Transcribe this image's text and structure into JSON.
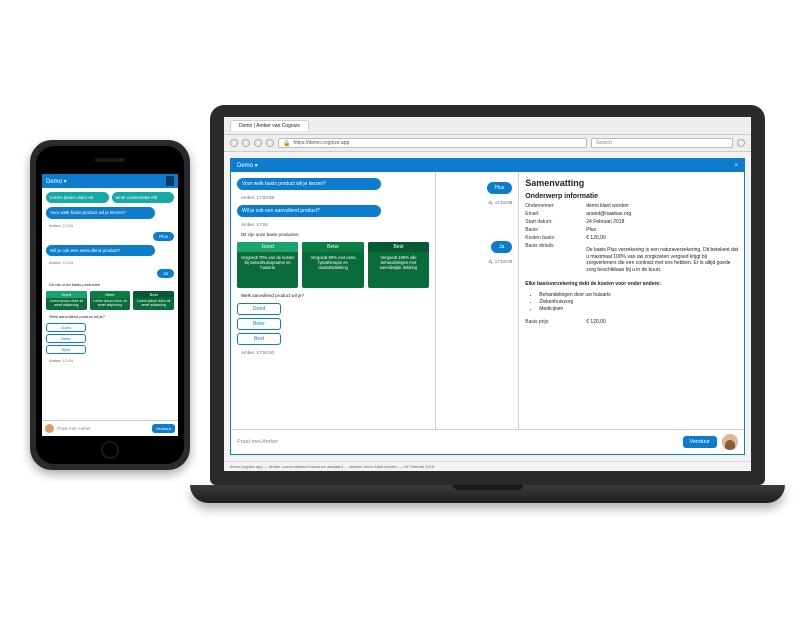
{
  "colors": {
    "primary": "#0d7ccd",
    "teal": "#17a9a7",
    "green": "#0a6b3c"
  },
  "phone": {
    "header_title": "Demo ▾",
    "intro1": "Lorem ipsum dolor sit",
    "intro2": "amet consectetur elit",
    "q1": "Voor welk basis product wil je kiezen?",
    "meta1": "Amber, 17:04",
    "reply1": "Plus",
    "q2": "Wil je ook een aanvullend product?",
    "meta2": "Amber, 17:04",
    "reply2": "Ja",
    "q3": "Dit zijn onze basis producten",
    "cards": [
      {
        "title": "Goed",
        "body": "Lorem ipsum dolor sit amet adipiscing"
      },
      {
        "title": "Beter",
        "body": "Lorem ipsum dolor sit amet adipiscing"
      },
      {
        "title": "Best",
        "body": "Lorem ipsum dolor sit amet adipiscing"
      }
    ],
    "q4": "Welk aanvullend product wil je?",
    "options": [
      "Goed",
      "Beter",
      "Best"
    ],
    "meta3": "Amber, 17:04",
    "input_placeholder": "Praat met Amber",
    "send": "Verstuur"
  },
  "browser": {
    "tab": "Demo | Amber van Cognize",
    "url": "https://demo.cognize.app",
    "search_placeholder": "Search"
  },
  "desktop": {
    "header_title": "Demo ▾",
    "q1": "Voor welk basis product wil je kiezen?",
    "meta1": "Amber, 17:03:59",
    "q2": "Wil je ook een aanvullend product?",
    "meta2": "Amber, 17:04",
    "q3": "Dit zijn onze basis producten",
    "cards": [
      {
        "title": "Goed",
        "body": "Vergoedt 70% van de kosten bij ziekenhuisopname en huisarts"
      },
      {
        "title": "Beter",
        "body": "Vergoedt 90% met extra fysiotherapie en tandartsdekking"
      },
      {
        "title": "Best",
        "body": "Vergoedt 100% alle behandelingen met wereldwijde dekking"
      }
    ],
    "q4": "Welk aanvullend product wil je?",
    "options": [
      "Goed",
      "Beter",
      "Best"
    ],
    "meta3": "Amber, 17:04:20",
    "responses": {
      "r1": "Plus",
      "r1_meta": "Jij, 17:03:59",
      "r2": "Ja",
      "r2_meta": "Jij, 17:04:09"
    },
    "input_placeholder": "Praat met Amber",
    "send": "Verstuur",
    "status": "demo.cognize.app — Amber conversational insurance assistant — session demo klant worden — 24 Februari 2018"
  },
  "summary": {
    "title": "Samenvatting",
    "section": "Onderwerp informatie",
    "rows": {
      "ondernemer_k": "Ondernemer:",
      "ondernemer_v": "demo klant worden",
      "email_k": "Email:",
      "email_v": "anand@nawbas.org",
      "start_k": "Start datum:",
      "start_v": "24 Februari 2018",
      "basis_k": "Basis:",
      "basis_v": "Plus",
      "kosten_k": "Kosten basis:",
      "kosten_v": "€ 120,00",
      "details_k": "Basis details:"
    },
    "para": "De basis Plus verzekering is een naturaverzekering. Dit betekent dat u maximaal 100% van uw zorgkosten vergoed krijgt bij zorgverleners die een contract met ons hebben. Er is altijd goede zorg beschikbaar bij u in de buurt.",
    "bold_line": "Elke basisverzekering dekt de kosten voor onder andere:",
    "bullets": [
      "Behandelingen door uw huisarts",
      "Ziekenhuiszorg",
      "Medicijnen"
    ],
    "price_k": "Basis prijs:",
    "price_v": "€ 120,00"
  }
}
